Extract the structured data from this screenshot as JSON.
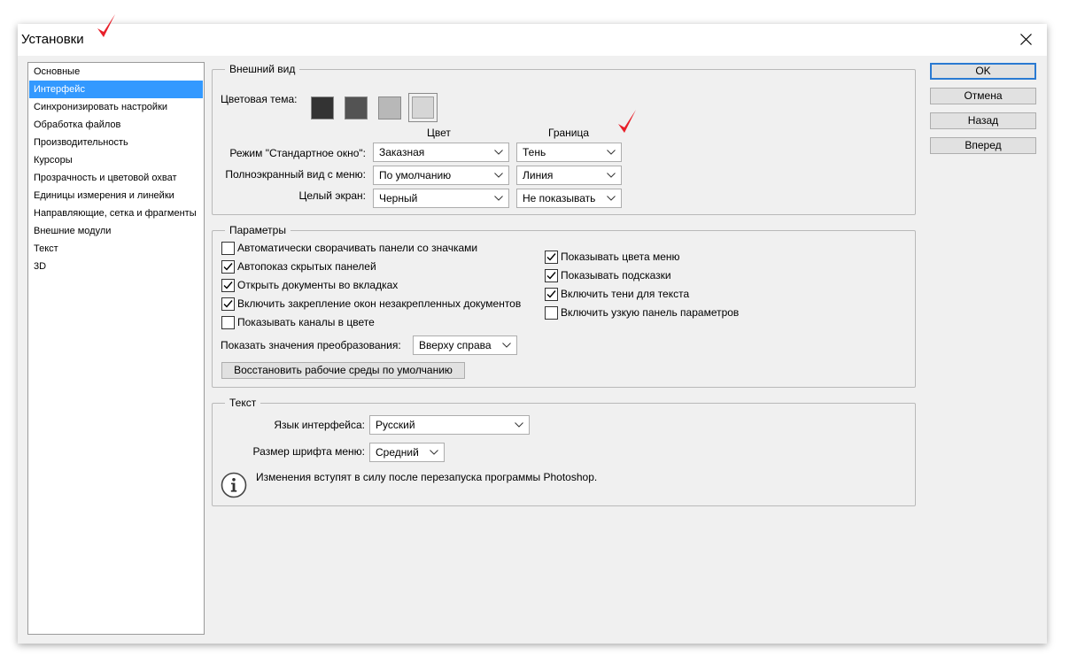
{
  "window": {
    "title": "Установки"
  },
  "sidebar": {
    "items": [
      {
        "label": "Основные",
        "selected": false
      },
      {
        "label": "Интерфейс",
        "selected": true
      },
      {
        "label": "Синхронизировать настройки",
        "selected": false
      },
      {
        "label": "Обработка файлов",
        "selected": false
      },
      {
        "label": "Производительность",
        "selected": false
      },
      {
        "label": "Курсоры",
        "selected": false
      },
      {
        "label": "Прозрачность и цветовой охват",
        "selected": false
      },
      {
        "label": "Единицы измерения и линейки",
        "selected": false
      },
      {
        "label": "Направляющие, сетка и фрагменты",
        "selected": false
      },
      {
        "label": "Внешние модули",
        "selected": false
      },
      {
        "label": "Текст",
        "selected": false
      },
      {
        "label": "3D",
        "selected": false
      }
    ]
  },
  "appearance": {
    "legend": "Внешний вид",
    "color_theme_label": "Цветовая тема:",
    "swatches": [
      "#333333",
      "#535353",
      "#b8b8b8",
      "#d6d6d6"
    ],
    "selected_swatch_index": 3,
    "col_color": "Цвет",
    "col_border": "Граница",
    "rows": [
      {
        "label": "Режим \"Стандартное окно\":",
        "color": "Заказная",
        "border": "Тень"
      },
      {
        "label": "Полноэкранный вид с меню:",
        "color": "По умолчанию",
        "border": "Линия"
      },
      {
        "label": "Целый экран:",
        "color": "Черный",
        "border": "Не показывать"
      }
    ]
  },
  "params": {
    "legend": "Параметры",
    "left_checks": [
      {
        "label": "Автоматически сворачивать панели со значками",
        "checked": false
      },
      {
        "label": "Автопоказ скрытых панелей",
        "checked": true
      },
      {
        "label": "Открыть документы во вкладках",
        "checked": true
      },
      {
        "label": "Включить закрепление окон незакрепленных документов",
        "checked": true
      },
      {
        "label": "Показывать каналы в цвете",
        "checked": false
      }
    ],
    "right_checks": [
      {
        "label": "Показывать цвета меню",
        "checked": true
      },
      {
        "label": "Показывать подсказки",
        "checked": true
      },
      {
        "label": "Включить тени для текста",
        "checked": true
      },
      {
        "label": "Включить узкую панель параметров",
        "checked": false
      }
    ],
    "transform_label": "Показать значения преобразования:",
    "transform_value": "Вверху справа",
    "restore_button": "Восстановить рабочие среды по умолчанию"
  },
  "text": {
    "legend": "Текст",
    "ui_lang_label": "Язык интерфейса:",
    "ui_lang_value": "Русский",
    "font_size_label": "Размер шрифта меню:",
    "font_size_value": "Средний",
    "info": "Изменения вступят в силу после перезапуска программы Photoshop."
  },
  "buttons": {
    "ok": "OK",
    "cancel": "Отмена",
    "back": "Назад",
    "forward": "Вперед"
  },
  "colors": {
    "accent": "#3399ff",
    "annotation": "#e8202a"
  },
  "icons": {
    "close": "close-icon",
    "check": "check-icon",
    "dropdown": "chevron-down-icon",
    "info": "info-icon",
    "annotation": "red-checkmark-icon"
  }
}
